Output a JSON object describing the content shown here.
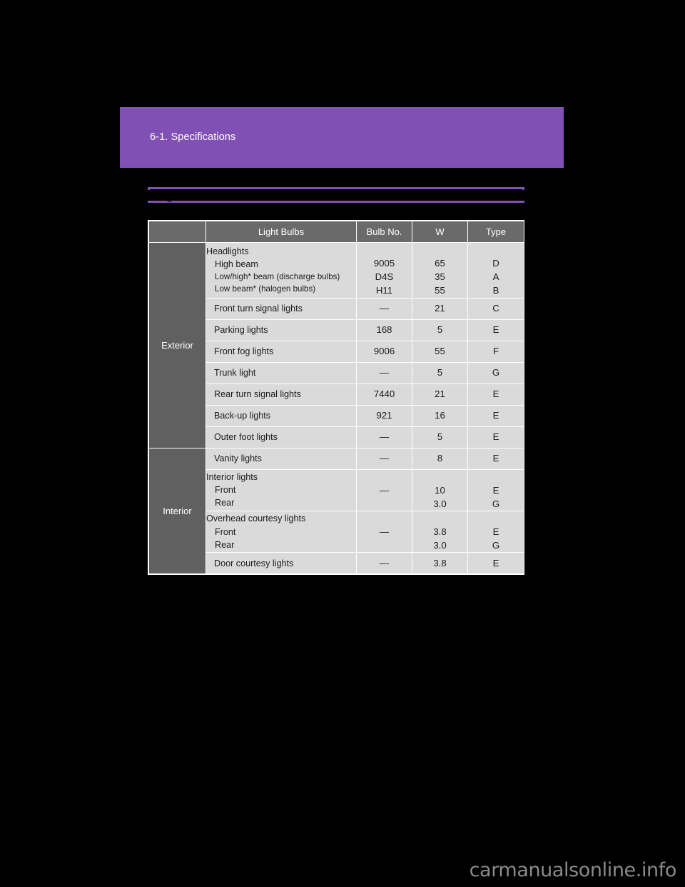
{
  "page": {
    "background_color": "#000000",
    "accent_color": "#8150b4",
    "watermark": "carmanualsonline.info"
  },
  "chapter_banner": {
    "title": "6-1. Specifications",
    "color": "#8150b4",
    "text_color": "#ffffff"
  },
  "section_heading": {
    "label": "Light bulbs",
    "border_color": "#8150b4",
    "note": "heading text is occluded by a black band in the source scan"
  },
  "table": {
    "header_bg": "#6a6a6a",
    "category_bg": "#606060",
    "cell_bg": "#dadada",
    "columns": [
      "",
      "Light Bulbs",
      "Bulb No.",
      "W",
      "Type"
    ],
    "groups": [
      {
        "category": "Exterior",
        "rows": [
          {
            "name_main": "Headlights",
            "name_subs": [
              "High beam",
              "Low/high* beam (discharge bulbs)",
              "Low beam* (halogen bulbs)"
            ],
            "bulb_no": [
              "9005",
              "D4S",
              "H11"
            ],
            "watts": [
              "65",
              "35",
              "55"
            ],
            "type": [
              "D",
              "A",
              "B"
            ],
            "multiline": true
          },
          {
            "name_main": "Front turn signal lights",
            "bulb_no": "—",
            "watts": "21",
            "type": "C"
          },
          {
            "name_main": "Parking lights",
            "bulb_no": "168",
            "watts": "5",
            "type": "E"
          },
          {
            "name_main": "Front fog lights",
            "bulb_no": "9006",
            "watts": "55",
            "type": "F"
          },
          {
            "name_main": "Trunk light",
            "bulb_no": "—",
            "watts": "5",
            "type": "G"
          },
          {
            "name_main": "Rear turn signal lights",
            "bulb_no": "7440",
            "watts": "21",
            "type": "E"
          },
          {
            "name_main": "Back-up lights",
            "bulb_no": "921",
            "watts": "16",
            "type": "E"
          },
          {
            "name_main": "Outer foot lights",
            "bulb_no": "—",
            "watts": "5",
            "type": "E"
          }
        ]
      },
      {
        "category": "Interior",
        "rows": [
          {
            "name_main": "Vanity lights",
            "bulb_no": "—",
            "watts": "8",
            "type": "E"
          },
          {
            "name_main": "Interior lights",
            "name_subs": [
              "Front",
              "Rear"
            ],
            "bulb_no": "—",
            "watts": [
              "10",
              "3.0"
            ],
            "type": [
              "E",
              "G"
            ],
            "multiline": true
          },
          {
            "name_main": "Overhead courtesy lights",
            "name_subs": [
              "Front",
              "Rear"
            ],
            "bulb_no": "—",
            "watts": [
              "3.8",
              "3.0"
            ],
            "type": [
              "E",
              "G"
            ],
            "multiline": true
          },
          {
            "name_main": "Door courtesy lights",
            "bulb_no": "—",
            "watts": "3.8",
            "type": "E"
          }
        ]
      }
    ]
  }
}
